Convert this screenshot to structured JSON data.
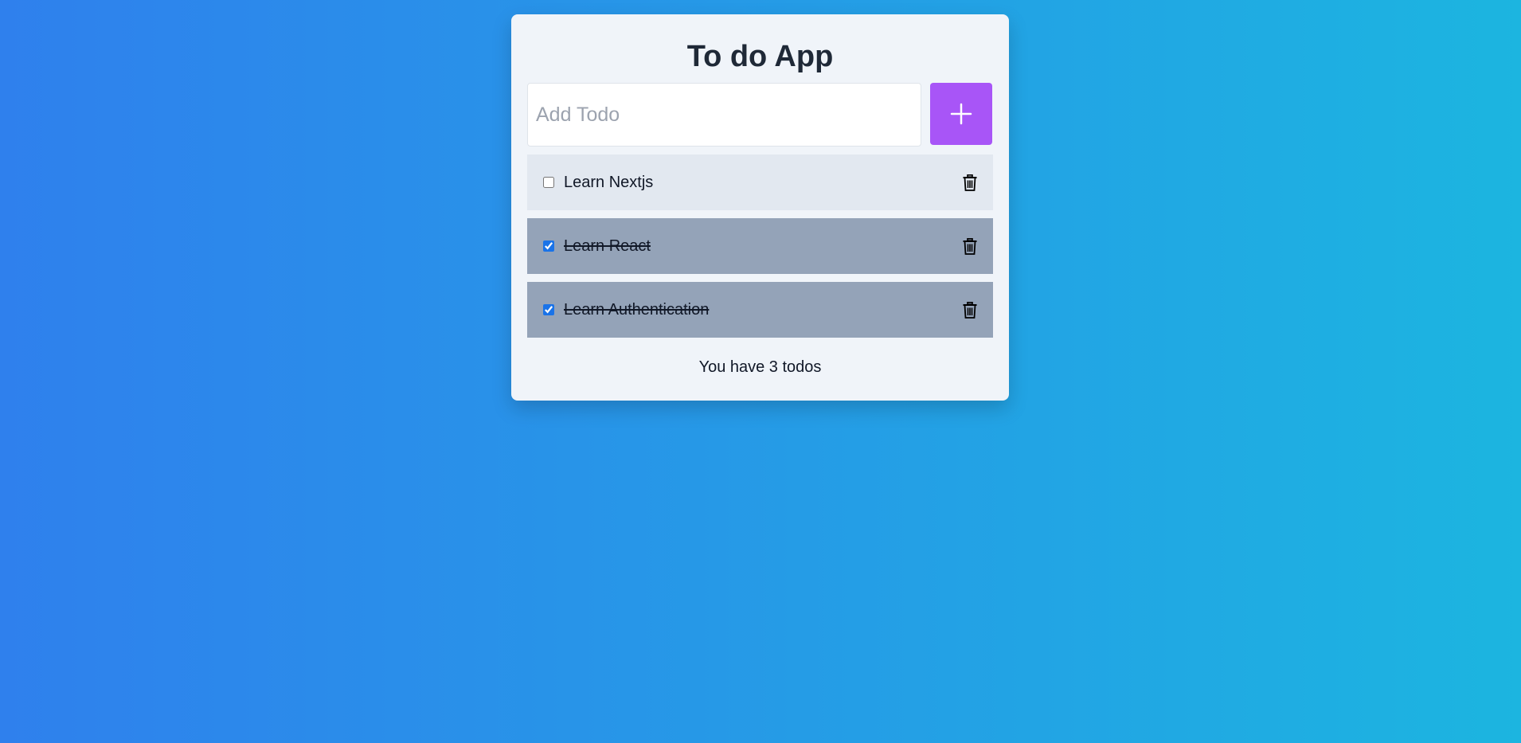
{
  "app": {
    "title": "To do App"
  },
  "input": {
    "placeholder": "Add Todo",
    "value": ""
  },
  "add_button": {
    "icon": "plus-icon"
  },
  "todos": [
    {
      "label": "Learn Nextjs",
      "completed": false
    },
    {
      "label": "Learn React",
      "completed": true
    },
    {
      "label": "Learn Authentication",
      "completed": true
    }
  ],
  "footer": {
    "count_text": "You have 3 todos"
  },
  "colors": {
    "background_start": "#2f80ed",
    "background_end": "#1cb5e0",
    "card": "#f0f4f9",
    "accent": "#a855f7",
    "item_pending": "#e2e8f0",
    "item_done": "#94a3b8"
  },
  "icons": {
    "delete": "trash-icon",
    "add": "plus-icon"
  }
}
